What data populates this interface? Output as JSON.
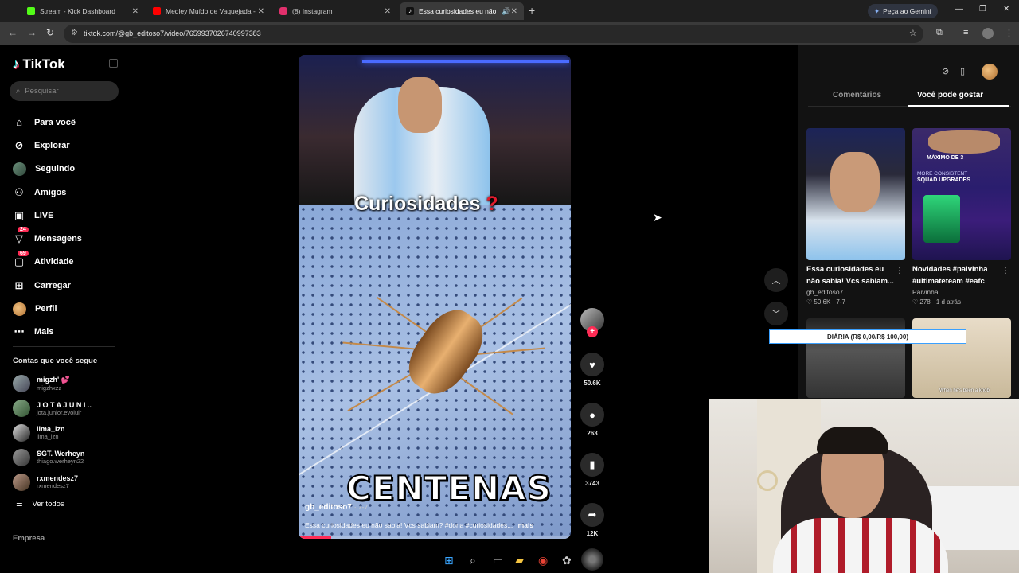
{
  "browser": {
    "tabs": [
      {
        "title": "Stream - Kick Dashboard",
        "color": "#53fc18"
      },
      {
        "title": "Medley Muído de Vaquejada -",
        "color": "#ff0000"
      },
      {
        "title": "(8) Instagram",
        "color": "#e1306c"
      },
      {
        "title": "Essa curiosidades eu não sa",
        "color": "#ffffff"
      }
    ],
    "gemini_label": "Peça ao Gemini",
    "url": "tiktok.com/@gb_editoso7/video/7659937026740997383"
  },
  "tiktok": {
    "logo": "TikTok",
    "search_placeholder": "Pesquisar",
    "menu": [
      {
        "label": "Para você",
        "icon": "home-icon"
      },
      {
        "label": "Explorar",
        "icon": "compass-icon"
      },
      {
        "label": "Seguindo",
        "icon": "avatar"
      },
      {
        "label": "Amigos",
        "icon": "friends-icon"
      },
      {
        "label": "LIVE",
        "icon": "live-icon"
      },
      {
        "label": "Mensagens",
        "icon": "messages-icon",
        "badge": "24"
      },
      {
        "label": "Atividade",
        "icon": "activity-icon",
        "badge": "69"
      },
      {
        "label": "Carregar",
        "icon": "upload-icon"
      },
      {
        "label": "Perfil",
        "icon": "avatar"
      },
      {
        "label": "Mais",
        "icon": "more-icon"
      }
    ],
    "following_title": "Contas que você segue",
    "following": [
      {
        "name": "migzh' 💕",
        "handle": "migzhxzz"
      },
      {
        "name": "J O T A  J U N I ..",
        "handle": "jota.junior.evoluir"
      },
      {
        "name": "lima_lzn",
        "handle": "lima_lzn"
      },
      {
        "name": "SGT. Werheyn",
        "handle": "thiago.werheyn22"
      },
      {
        "name": "rxmendesz7",
        "handle": "rxmendesz7"
      }
    ],
    "see_all": "Ver todos",
    "empresa": "Empresa",
    "video": {
      "caption_top": "Curiosidades",
      "caption_top_mark": "?",
      "caption_big": "CENTENAS",
      "author": "gb_editoso7",
      "date": "· 7-7",
      "description": "Essa curiosidades eu não sabia! Vcs sabiam? #dona #curiosidades...",
      "more": "mais",
      "progress": 0.12
    },
    "actions": {
      "likes": "50.6K",
      "comments": "263",
      "saves": "3743",
      "shares": "12K"
    },
    "panel": {
      "tabs": [
        "Comentários",
        "Você pode gostar"
      ],
      "active_tab": 1,
      "cards": [
        {
          "title": "Essa curiosidades eu não sabia! Vcs sabiam...",
          "author": "gb_editoso7",
          "meta": "♡ 50.6K · 7-7"
        },
        {
          "title": "Novidades #paivinha #ultimateteam #eafc",
          "author": "Paivinha",
          "meta": "♡ 278 · 1 d atrás"
        }
      ],
      "thumb_text": {
        "b1": "MÁXIMO DE 3",
        "b2": "MORE CONSISTENT",
        "b3": "SQUAD UPGRADES",
        "d1": "When he's been a knob"
      }
    }
  },
  "overlay": {
    "daily_label": "DIÁRIA (R$ 0,00/R$ 100,00)"
  }
}
